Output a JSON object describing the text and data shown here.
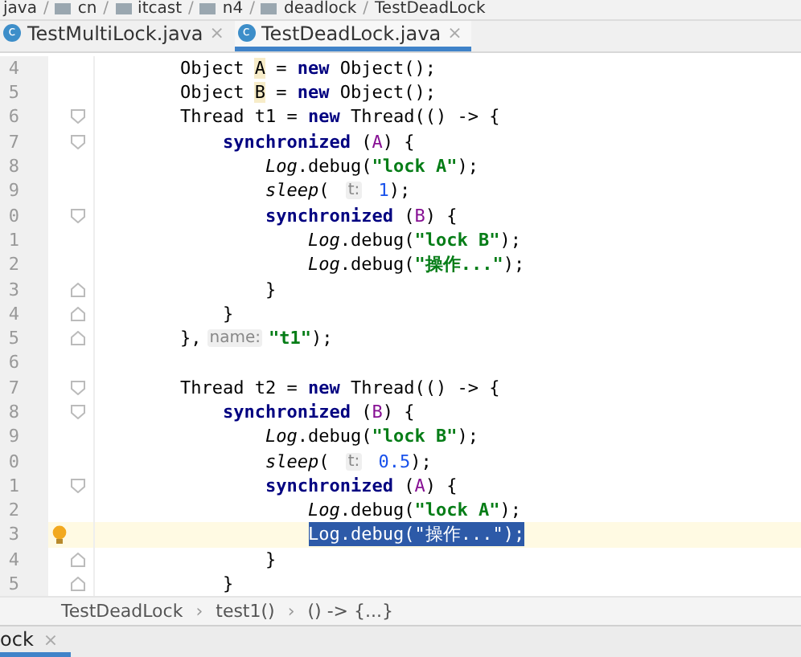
{
  "nav_bar": {
    "separator": "/",
    "items": [
      "java",
      "cn",
      "itcast",
      "n4",
      "deadlock",
      "TestDeadLock"
    ]
  },
  "tabs": [
    {
      "icon_letter": "c",
      "label": "TestMultiLock.java",
      "selected": false,
      "close": "×"
    },
    {
      "icon_letter": "c",
      "label": "TestDeadLock.java",
      "selected": true,
      "close": "×"
    }
  ],
  "editor": {
    "lines": [
      {
        "number": "4",
        "fold_start": false,
        "fold_end": false,
        "current": false,
        "bulb": false,
        "tokens": [
          {
            "kind": "plain",
            "text": "Object "
          },
          {
            "kind": "var",
            "text": "A"
          },
          {
            "kind": "plain",
            "text": " = "
          },
          {
            "kind": "kw",
            "text": "new"
          },
          {
            "kind": "plain",
            "text": " Object();"
          }
        ]
      },
      {
        "number": "5",
        "fold_start": false,
        "fold_end": false,
        "current": false,
        "bulb": false,
        "tokens": [
          {
            "kind": "plain",
            "text": "Object "
          },
          {
            "kind": "var",
            "text": "B"
          },
          {
            "kind": "plain",
            "text": " = "
          },
          {
            "kind": "kw",
            "text": "new"
          },
          {
            "kind": "plain",
            "text": " Object();"
          }
        ]
      },
      {
        "number": "6",
        "fold_start": true,
        "fold_end": false,
        "current": false,
        "bulb": false,
        "tokens": [
          {
            "kind": "plain",
            "text": "Thread t1 = "
          },
          {
            "kind": "kw",
            "text": "new"
          },
          {
            "kind": "plain",
            "text": " Thread(() -> {"
          }
        ]
      },
      {
        "number": "7",
        "fold_start": true,
        "fold_end": false,
        "current": false,
        "bulb": false,
        "tokens": [
          {
            "kind": "kw",
            "text": "synchronized"
          },
          {
            "kind": "plain",
            "text": " ("
          },
          {
            "kind": "field",
            "text": "A"
          },
          {
            "kind": "plain",
            "text": ") {"
          }
        ]
      },
      {
        "number": "8",
        "fold_start": false,
        "fold_end": false,
        "current": false,
        "bulb": false,
        "tokens": [
          {
            "kind": "static",
            "text": "Log"
          },
          {
            "kind": "plain",
            "text": ".debug("
          },
          {
            "kind": "str",
            "text": "\"lock A\""
          },
          {
            "kind": "plain",
            "text": ");"
          }
        ]
      },
      {
        "number": "9",
        "fold_start": false,
        "fold_end": false,
        "current": false,
        "bulb": false,
        "tokens": [
          {
            "kind": "static",
            "text": "sleep"
          },
          {
            "kind": "plain",
            "text": "( "
          },
          {
            "kind": "hint",
            "text": "t:"
          },
          {
            "kind": "num",
            "text": " 1"
          },
          {
            "kind": "plain",
            "text": ");"
          }
        ]
      },
      {
        "number": "0",
        "fold_start": true,
        "fold_end": false,
        "current": false,
        "bulb": false,
        "tokens": [
          {
            "kind": "kw",
            "text": "synchronized"
          },
          {
            "kind": "plain",
            "text": " ("
          },
          {
            "kind": "field",
            "text": "B"
          },
          {
            "kind": "plain",
            "text": ") {"
          }
        ]
      },
      {
        "number": "1",
        "fold_start": false,
        "fold_end": false,
        "current": false,
        "bulb": false,
        "tokens": [
          {
            "kind": "static",
            "text": "Log"
          },
          {
            "kind": "plain",
            "text": ".debug("
          },
          {
            "kind": "str",
            "text": "\"lock B\""
          },
          {
            "kind": "plain",
            "text": ");"
          }
        ]
      },
      {
        "number": "2",
        "fold_start": false,
        "fold_end": false,
        "current": false,
        "bulb": false,
        "tokens": [
          {
            "kind": "static",
            "text": "Log"
          },
          {
            "kind": "plain",
            "text": ".debug("
          },
          {
            "kind": "str",
            "text": "\"操作...\""
          },
          {
            "kind": "plain",
            "text": ");"
          }
        ]
      },
      {
        "number": "3",
        "fold_start": false,
        "fold_end": true,
        "current": false,
        "bulb": false,
        "tokens": [
          {
            "kind": "plain",
            "text": "}"
          }
        ]
      },
      {
        "number": "4",
        "fold_start": false,
        "fold_end": true,
        "current": false,
        "bulb": false,
        "tokens": [
          {
            "kind": "plain",
            "text": "}"
          }
        ]
      },
      {
        "number": "5",
        "fold_start": false,
        "fold_end": true,
        "current": false,
        "bulb": false,
        "tokens": [
          {
            "kind": "plain",
            "text": "},"
          },
          {
            "kind": "hint",
            "text": "name:"
          },
          {
            "kind": "str",
            "text": "\"t1\""
          },
          {
            "kind": "plain",
            "text": ");"
          }
        ]
      },
      {
        "number": "6",
        "fold_start": false,
        "fold_end": false,
        "current": false,
        "bulb": false
      },
      {
        "number": "7",
        "fold_start": true,
        "fold_end": false,
        "current": false,
        "bulb": false,
        "tokens": [
          {
            "kind": "plain",
            "text": "Thread t2 = "
          },
          {
            "kind": "kw",
            "text": "new"
          },
          {
            "kind": "plain",
            "text": " Thread(() -> {"
          }
        ]
      },
      {
        "number": "8",
        "fold_start": true,
        "fold_end": false,
        "current": false,
        "bulb": false,
        "tokens": [
          {
            "kind": "kw",
            "text": "synchronized"
          },
          {
            "kind": "plain",
            "text": " ("
          },
          {
            "kind": "field",
            "text": "B"
          },
          {
            "kind": "plain",
            "text": ") {"
          }
        ]
      },
      {
        "number": "9",
        "fold_start": false,
        "fold_end": false,
        "current": false,
        "bulb": false,
        "tokens": [
          {
            "kind": "static",
            "text": "Log"
          },
          {
            "kind": "plain",
            "text": ".debug("
          },
          {
            "kind": "str",
            "text": "\"lock B\""
          },
          {
            "kind": "plain",
            "text": ");"
          }
        ]
      },
      {
        "number": "0",
        "fold_start": false,
        "fold_end": false,
        "current": false,
        "bulb": false,
        "tokens": [
          {
            "kind": "static",
            "text": "sleep"
          },
          {
            "kind": "plain",
            "text": "( "
          },
          {
            "kind": "hint",
            "text": "t:"
          },
          {
            "kind": "num",
            "text": " 0.5"
          },
          {
            "kind": "plain",
            "text": ");"
          }
        ]
      },
      {
        "number": "1",
        "fold_start": true,
        "fold_end": false,
        "current": false,
        "bulb": false,
        "tokens": [
          {
            "kind": "kw",
            "text": "synchronized"
          },
          {
            "kind": "plain",
            "text": " ("
          },
          {
            "kind": "field",
            "text": "A"
          },
          {
            "kind": "plain",
            "text": ") {"
          }
        ]
      },
      {
        "number": "2",
        "fold_start": false,
        "fold_end": false,
        "current": false,
        "bulb": false,
        "tokens": [
          {
            "kind": "static",
            "text": "Log"
          },
          {
            "kind": "plain",
            "text": ".debug("
          },
          {
            "kind": "str",
            "text": "\"lock A\""
          },
          {
            "kind": "plain",
            "text": ");"
          }
        ]
      },
      {
        "number": "3",
        "fold_start": false,
        "fold_end": false,
        "current": true,
        "bulb": true,
        "selection": "Log.debug(\"操作...\");"
      },
      {
        "number": "4",
        "fold_start": false,
        "fold_end": true,
        "current": false,
        "bulb": false,
        "tokens": [
          {
            "kind": "plain",
            "text": "}"
          }
        ]
      },
      {
        "number": "5",
        "fold_start": false,
        "fold_end": true,
        "current": false,
        "bulb": false,
        "tokens": [
          {
            "kind": "plain",
            "text": "}"
          }
        ]
      }
    ]
  },
  "breadcrumbs": {
    "separator": "›",
    "items": [
      "TestDeadLock",
      "test1()",
      "() -> {...}"
    ]
  },
  "bottom_tabs": [
    {
      "label": "ock",
      "selected": true,
      "close": "×"
    }
  ]
}
